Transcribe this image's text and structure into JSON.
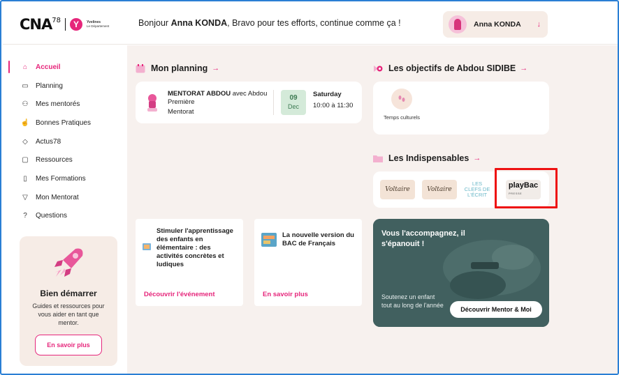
{
  "header": {
    "logo_text": "CNA",
    "logo_sup": "78",
    "logo_y": "Y",
    "logo_dep_line1": "Yvelines",
    "logo_dep_line2": "Le Département",
    "greeting_pre": "Bonjour ",
    "greeting_name": "Anna KONDA",
    "greeting_post": ", Bravo pour tes efforts, continue comme ça !",
    "user_name": "Anna KONDA",
    "user_chevron": "↓"
  },
  "sidebar": {
    "items": [
      {
        "label": "Accueil",
        "icon": "⌂"
      },
      {
        "label": "Planning",
        "icon": "▭"
      },
      {
        "label": "Mes mentorés",
        "icon": "⚇"
      },
      {
        "label": "Bonnes Pratiques",
        "icon": "☝"
      },
      {
        "label": "Actus78",
        "icon": "◇"
      },
      {
        "label": "Ressources",
        "icon": "▢"
      },
      {
        "label": "Mes Formations",
        "icon": "▯"
      },
      {
        "label": "Mon Mentorat",
        "icon": "▽"
      },
      {
        "label": "Questions",
        "icon": "?"
      }
    ],
    "start_card": {
      "title": "Bien démarrer",
      "text": "Guides et ressources pour vous aider en tant que mentor.",
      "button": "En savoir plus"
    }
  },
  "planning": {
    "title": "Mon planning",
    "arrow": "→",
    "event_title_bold": "MENTORAT ABDOU",
    "event_title_rest": " avec Abdou Première",
    "event_sub": "Mentorat",
    "date_day": "09",
    "date_month": "Dec",
    "weekday": "Saturday",
    "time": "10:00 à 11:30"
  },
  "objectives": {
    "title": "Les objectifs de Abdou SIDIBE",
    "arrow": "→",
    "item_icon": "footprints-icon",
    "item_label": "Temps culturels"
  },
  "essentials": {
    "title": "Les Indispensables",
    "arrow": "→",
    "resources": [
      {
        "label": "Voltaire"
      },
      {
        "label": "Voltaire"
      },
      {
        "label": "LES CLEFS DE L'ÉCRIT"
      },
      {
        "label": "playBac",
        "sub": "PRESSE"
      }
    ]
  },
  "events": [
    {
      "title": "Stimuler l'apprentissage des enfants en élémentaire : des activités concrètes et ludiques",
      "link": "Découvrir l'événement"
    },
    {
      "title": "La nouvelle version du BAC de Français",
      "link": "En savoir plus"
    }
  ],
  "promo": {
    "title": "Vous l'accompagnez, il s'épanouit !",
    "text": "Soutenez un enfant tout au long de l'année",
    "button": "Découvrir Mentor & Moi"
  },
  "colors": {
    "accent": "#e6267b",
    "sidebar_card": "#f6ece6",
    "main_bg": "#f7f1ee",
    "promo_bg": "#3f5d5e",
    "date_bg": "#d4ead9",
    "highlight": "#ee1111"
  }
}
